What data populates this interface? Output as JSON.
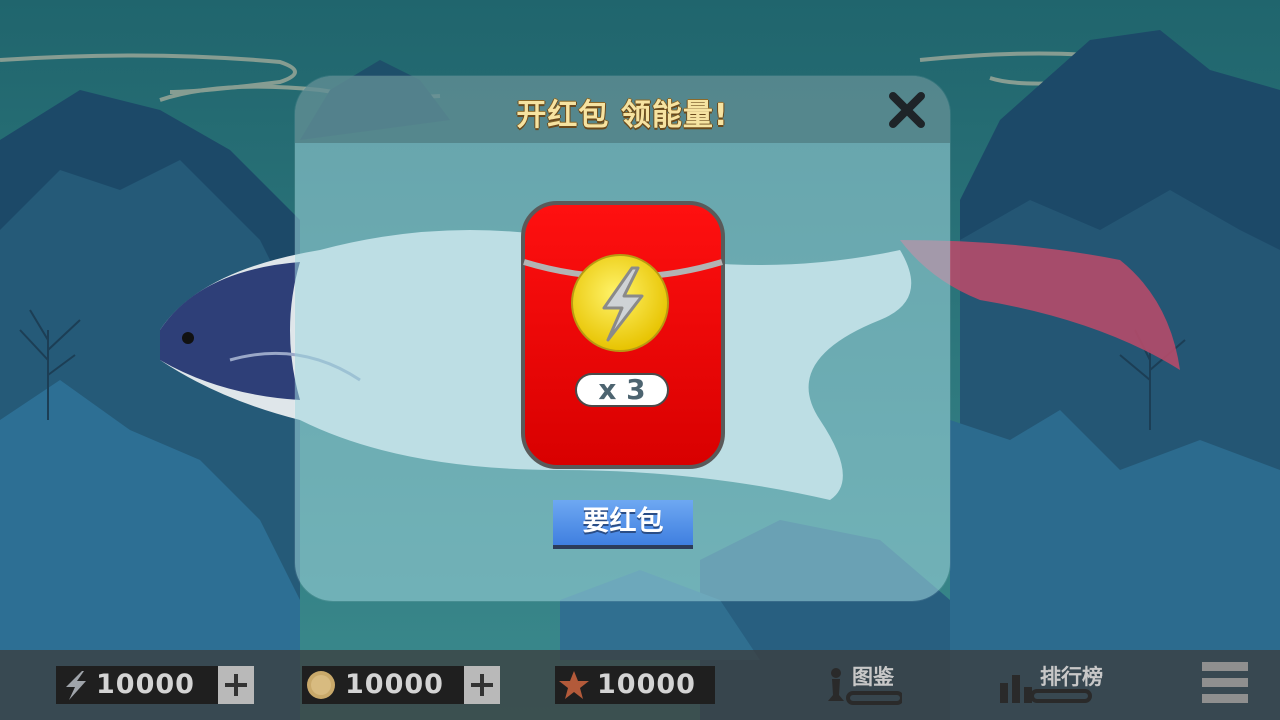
{
  "dialog": {
    "title": "开红包 领能量!",
    "reward_count": "x 3",
    "claim_label": "要红包"
  },
  "resources": {
    "energy": "10000",
    "coins": "10000",
    "stars": "10000"
  },
  "nav": {
    "codex_label": "图鉴",
    "leaderboard_label": "排行榜"
  },
  "icons": {
    "close": "close-icon",
    "energy": "lightning-icon",
    "coin": "coin-icon",
    "star": "star-icon",
    "codex": "chess-piece-icon",
    "leaderboard": "bar-chart-icon",
    "menu": "menu-icon"
  },
  "colors": {
    "envelope_red": "#e60000",
    "title_gold": "#f6e3a1",
    "button_blue": "#4f8ce8",
    "sky_teal": "#2a6b73"
  }
}
